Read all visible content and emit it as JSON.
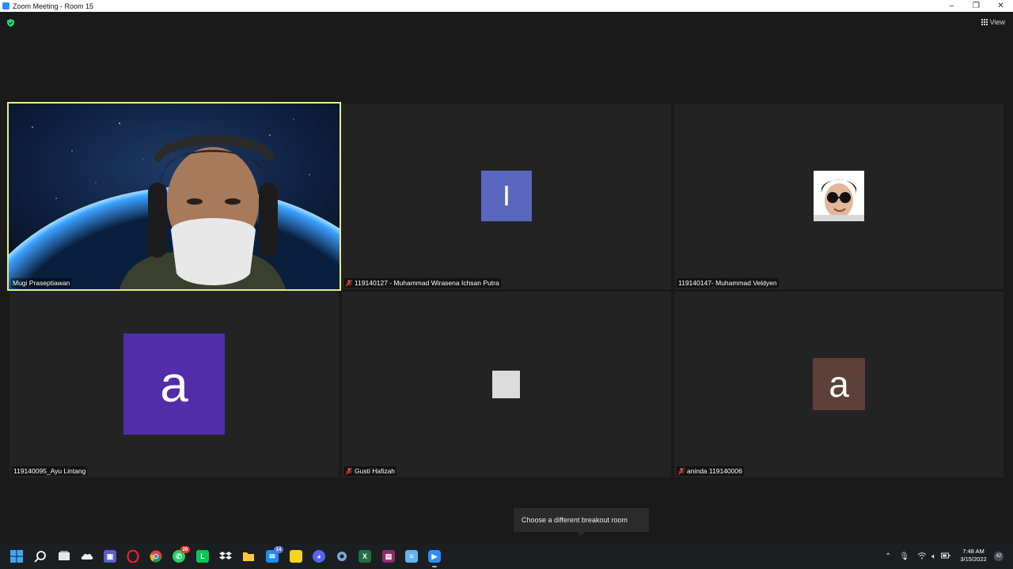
{
  "window": {
    "title": "Zoom Meeting - Room 15",
    "view_label": "View",
    "controls": {
      "minimize": "–",
      "restore": "❐",
      "close": "✕"
    }
  },
  "participants": [
    {
      "name": "Mugi Praseptiawan",
      "muted": false,
      "active_speaker": true,
      "video": "camera"
    },
    {
      "name": "119140127 - Muhammad Wirasena Ichsan Putra",
      "muted": true,
      "avatar_letter": "I",
      "avatar_color": "#5a67bf"
    },
    {
      "name": "119140147- Muhammad Veldyen",
      "muted": false,
      "avatar": "profile-photo"
    },
    {
      "name": "119140095_Ayu Lintang",
      "muted": false,
      "avatar_letter": "a",
      "avatar_color": "#512daa"
    },
    {
      "name": "Gusti Hafizah",
      "muted": true,
      "avatar_color": "#dcdcdc"
    },
    {
      "name": "aninda 119140006",
      "muted": true,
      "avatar_letter": "a",
      "avatar_color": "#5d4037"
    }
  ],
  "tooltip": {
    "text": "Choose a different breakout room"
  },
  "taskbar": {
    "icons": [
      "windows-start-icon",
      "search-icon",
      "task-view-icon",
      "onedrive-icon",
      "teams-chat-icon",
      "opera-icon",
      "chrome-icon",
      "whatsapp-icon",
      "line-icon",
      "dropbox-icon",
      "file-explorer-icon",
      "mail-icon",
      "sticky-notes-icon",
      "discord-icon",
      "settings-icon",
      "excel-icon",
      "winrar-icon",
      "notepad-icon",
      "zoom-icon"
    ],
    "badges": {
      "whatsapp": "20",
      "mail": "14"
    },
    "clock_time": "7:48 AM",
    "clock_date": "3/15/2022",
    "notification_count": "42"
  },
  "colors": {
    "accent_active_border": "#e8f08a",
    "muted_red": "#e04545",
    "background": "#1a1a1a",
    "tile": "#232323"
  }
}
